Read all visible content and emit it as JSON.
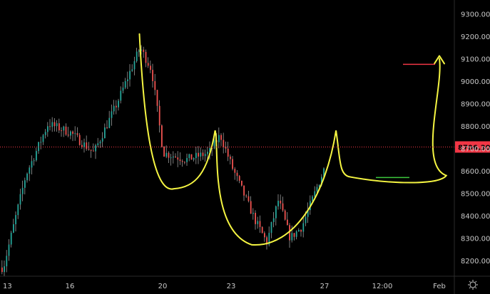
{
  "chart_data": {
    "type": "candlestick",
    "symbol": "",
    "x_ticks": [
      "13",
      "16",
      "20",
      "23",
      "27",
      "12:00",
      "Feb"
    ],
    "y_ticks": [
      8200,
      8300,
      8400,
      8500,
      8600,
      8700,
      8800,
      8900,
      9000,
      9100,
      9200,
      9300
    ],
    "ylim": [
      8130,
      9330
    ],
    "current_price": {
      "value": 8706.3,
      "label": "8706.30",
      "color": "#f23645"
    },
    "colors": {
      "up": "#26a69a",
      "down": "#ef5350",
      "wick": "#9a9a9a",
      "drawing": "#f5f542",
      "background": "#000000",
      "axis": "#2a2a2a"
    },
    "key_price_path": [
      {
        "x": "12",
        "y": 8150
      },
      {
        "x": "13",
        "y": 8170
      },
      {
        "x": "14",
        "y": 8580
      },
      {
        "x": "15",
        "y": 8810
      },
      {
        "x": "16",
        "y": 8770
      },
      {
        "x": "17",
        "y": 8680
      },
      {
        "x": "18",
        "y": 8900
      },
      {
        "x": "19",
        "y": 9150
      },
      {
        "x": "19.5",
        "y": 9050
      },
      {
        "x": "20",
        "y": 8680
      },
      {
        "x": "21",
        "y": 8650
      },
      {
        "x": "22",
        "y": 8680
      },
      {
        "x": "22.5",
        "y": 8760
      },
      {
        "x": "23",
        "y": 8620
      },
      {
        "x": "24",
        "y": 8380
      },
      {
        "x": "24.5",
        "y": 8280
      },
      {
        "x": "25",
        "y": 8470
      },
      {
        "x": "25.5",
        "y": 8300
      },
      {
        "x": "26",
        "y": 8350
      },
      {
        "x": "27",
        "y": 8620
      }
    ],
    "drawings": [
      {
        "kind": "cup-and-handle",
        "points": [
          [
            9210,
            19
          ],
          [
            8520,
            20.5
          ],
          [
            8780,
            22.3
          ],
          [
            8270,
            24.5
          ],
          [
            8780,
            27.2
          ],
          [
            8560,
            28.5
          ],
          [
            9100,
            "Feb"
          ]
        ]
      },
      {
        "kind": "horizontal-segment",
        "color": "#f23645",
        "price": 9075
      },
      {
        "kind": "horizontal-segment",
        "color": "#3cc83c",
        "price": 8570
      }
    ]
  }
}
